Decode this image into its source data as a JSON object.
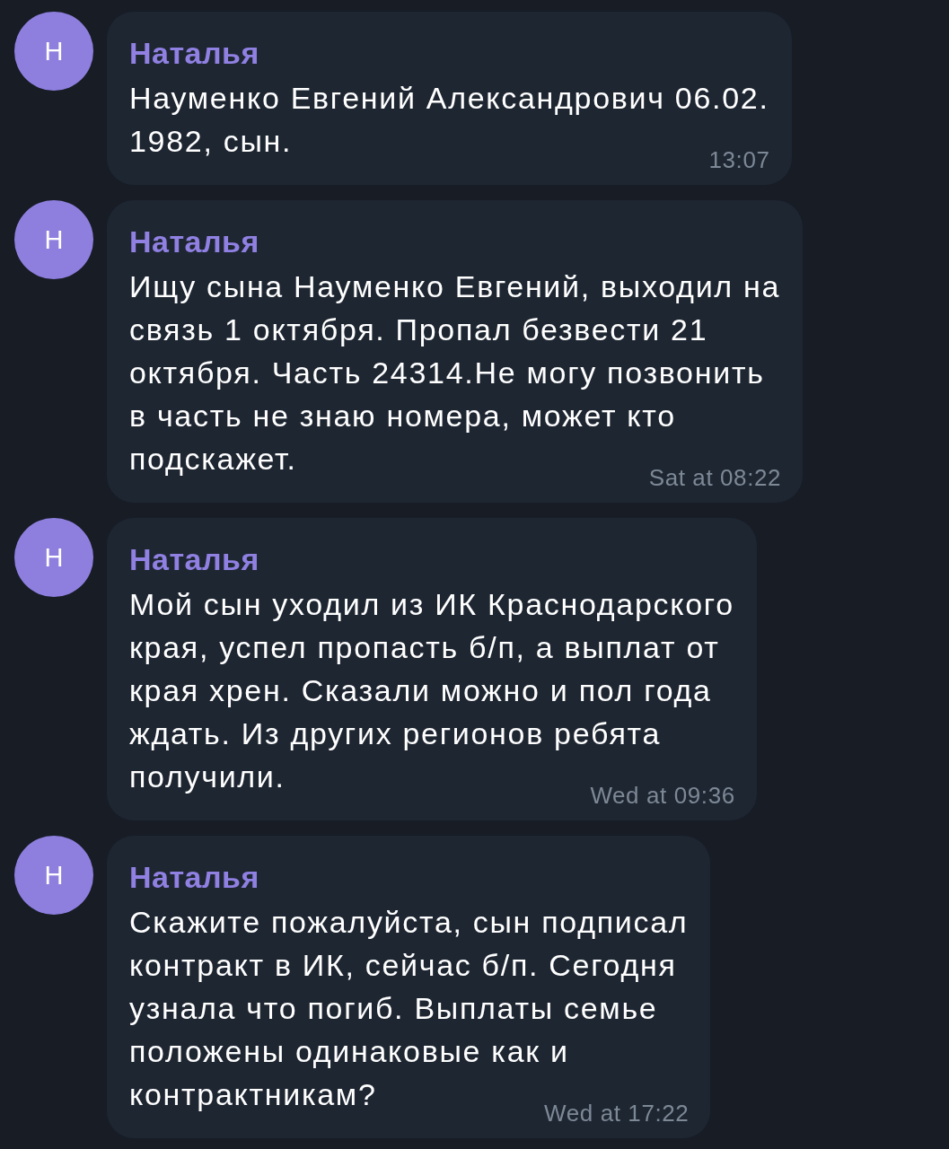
{
  "messages": [
    {
      "sender": "Наталья",
      "avatar_letter": "Н",
      "lines": [
        "Науменко Евгений Александрович 06.02.",
        "1982, сын."
      ],
      "time": "13:07"
    },
    {
      "sender": "Наталья",
      "avatar_letter": "Н",
      "lines": [
        "Ищу сына Науменко Евгений, выходил на",
        "связь 1 октября. Пропал безвести 21",
        "октября. Часть 24314.Не могу позвонить",
        "в часть не знаю номера, может кто",
        "подскажет."
      ],
      "time": "Sat at 08:22"
    },
    {
      "sender": "Наталья",
      "avatar_letter": "Н",
      "lines": [
        "Мой сын уходил из ИК Краснодарского",
        "края, успел пропасть б/п, а выплат от",
        "края хрен. Сказали можно и пол года",
        "ждать. Из других регионов ребята",
        "получили."
      ],
      "time": "Wed at 09:36"
    },
    {
      "sender": "Наталья",
      "avatar_letter": "Н",
      "lines": [
        "Скажите пожалуйста, сын подписал",
        "контракт в ИК, сейчас б/п. Сегодня",
        "узнала что погиб. Выплаты семье",
        "положены одинаковые как и",
        "контрактникам?"
      ],
      "time": "Wed at 17:22"
    }
  ]
}
